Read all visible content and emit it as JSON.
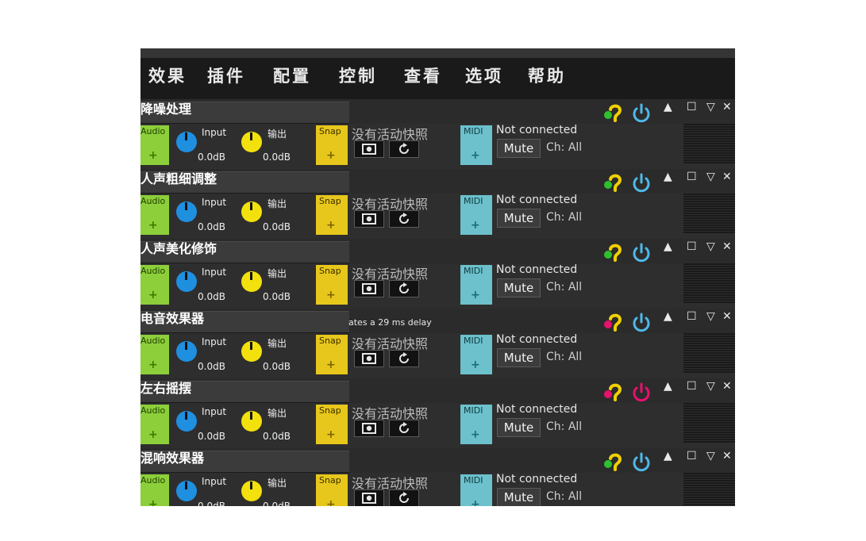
{
  "menu": [
    "效果",
    "插件",
    "配置",
    "控制",
    "查看",
    "选项",
    "帮助"
  ],
  "common": {
    "audio_label": "Audio",
    "input_label": "Input",
    "output_label": "输出",
    "snap_label": "Snap",
    "snapshot_status": "没有活动快照",
    "midi_label": "MIDI",
    "midi_status": "Not connected",
    "mute_label": "Mute",
    "channel_label": "Ch: All",
    "plus": "+",
    "db_value": "0.0dB"
  },
  "window_icons": {
    "options": "▲",
    "maximize": "☐",
    "collapse": "▽",
    "close": "✕"
  },
  "slots": [
    {
      "name": "降噪处理",
      "subtitle": "",
      "assist_color": "#2ec02e",
      "power_color": "#4fb8e8"
    },
    {
      "name": "人声粗细调整",
      "subtitle": "",
      "assist_color": "#2ec02e",
      "power_color": "#4fb8e8"
    },
    {
      "name": "人声美化修饰",
      "subtitle": "",
      "assist_color": "#2ec02e",
      "power_color": "#4fb8e8"
    },
    {
      "name": "电音效果器",
      "subtitle": "ates a 29 ms delay",
      "assist_color": "#e8116e",
      "power_color": "#4fb8e8"
    },
    {
      "name": "左右摇摆",
      "subtitle": "",
      "assist_color": "#e8116e",
      "power_color": "#e8116e"
    },
    {
      "name": "混响效果器",
      "subtitle": "",
      "assist_color": "#2ec02e",
      "power_color": "#4fb8e8"
    }
  ],
  "colors": {
    "audio": "#8ccf3a",
    "snap": "#e7c71b",
    "midi": "#6cc1cc",
    "knob_input": "#1f8fe0",
    "knob_output": "#f2e10c",
    "assist_hook": "#f0d000"
  }
}
